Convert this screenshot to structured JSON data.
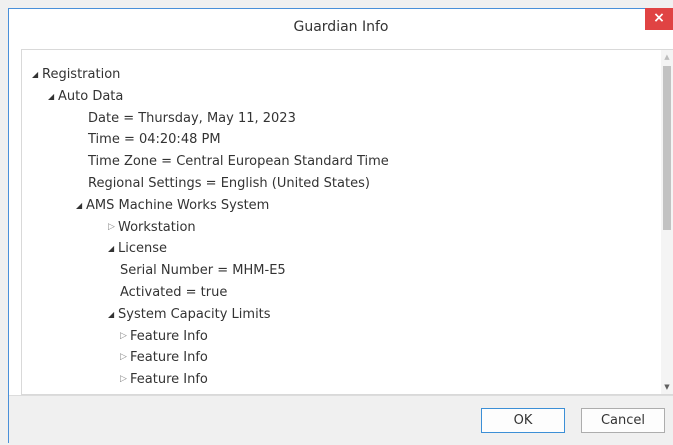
{
  "window": {
    "title": "Guardian Info",
    "close_label": "×"
  },
  "tree": {
    "expanded_glyph": "◢",
    "collapsed_glyph": "▷",
    "items": [
      {
        "label": "Registration",
        "level": 0,
        "state": "expanded"
      },
      {
        "label": "Auto Data",
        "level": 1,
        "state": "expanded"
      },
      {
        "label": "Date = Thursday, May 11, 2023",
        "level": 2,
        "state": "leaf"
      },
      {
        "label": "Time = 04:20:48 PM",
        "level": 2,
        "state": "leaf"
      },
      {
        "label": "Time Zone = Central European Standard Time",
        "level": 2,
        "state": "leaf"
      },
      {
        "label": "Regional Settings = English (United States)",
        "level": 2,
        "state": "leaf"
      },
      {
        "label": "AMS Machine Works System",
        "level": 2,
        "state": "expanded"
      },
      {
        "label": "Workstation",
        "level": 3,
        "state": "collapsed"
      },
      {
        "label": "License",
        "level": 3,
        "state": "expanded"
      },
      {
        "label": "Serial Number = MHM-E5",
        "level": 4,
        "state": "leaf"
      },
      {
        "label": "Activated = true",
        "level": 4,
        "state": "leaf"
      },
      {
        "label": "System Capacity Limits",
        "level": 4,
        "state": "expanded"
      },
      {
        "label": "Feature Info",
        "level": 5,
        "state": "collapsed"
      },
      {
        "label": "Feature Info",
        "level": 5,
        "state": "collapsed"
      },
      {
        "label": "Feature Info",
        "level": 5,
        "state": "collapsed"
      }
    ]
  },
  "scrollbar": {
    "up_glyph": "▲",
    "down_glyph": "▼"
  },
  "buttons": {
    "ok_label": "OK",
    "cancel_label": "Cancel"
  }
}
